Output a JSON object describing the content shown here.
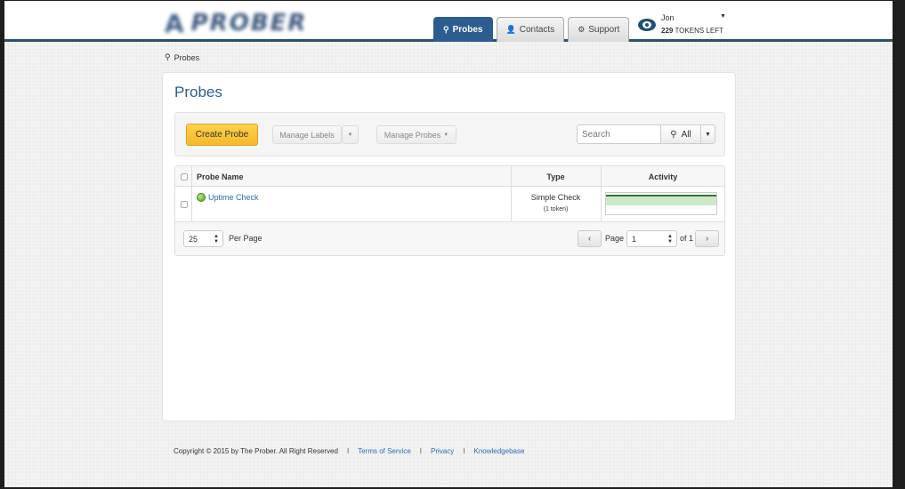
{
  "header": {
    "logo_mark": "A",
    "logo_text": "PROBER",
    "tabs": [
      {
        "label": "Probes",
        "icon": "map-pin-icon",
        "active": true
      },
      {
        "label": "Contacts",
        "icon": "user-icon",
        "active": false
      },
      {
        "label": "Support",
        "icon": "gear-icon",
        "active": false
      }
    ],
    "user": {
      "name": "Jon",
      "tokens_count": "229",
      "tokens_label": "TOKENS LEFT"
    }
  },
  "breadcrumb": {
    "label": "Probes"
  },
  "main": {
    "title": "Probes",
    "toolbar": {
      "create_label": "Create Probe",
      "manage_labels": "Manage Labels",
      "manage_probes": "Manage Probes",
      "search_placeholder": "Search",
      "search_scope": "All"
    },
    "table": {
      "headers": {
        "name": "Probe Name",
        "type": "Type",
        "activity": "Activity"
      },
      "rows": [
        {
          "name": "Uptime Check",
          "type": "Simple Check",
          "tokens": "(1 token)",
          "status": "up"
        }
      ],
      "footer": {
        "per_page_value": "25",
        "per_page_label": "Per Page",
        "page_label": "Page",
        "page_value": "1",
        "of_label": "of 1"
      }
    }
  },
  "footer": {
    "copyright": "Copyright © 2015 by The Prober. All Right Reserved",
    "separator": "I",
    "links": [
      "Terms of Service",
      "Privacy",
      "Knowledgebase"
    ]
  },
  "colors": {
    "brand": "#2b5d8e",
    "create_button": "#f5b82a",
    "link": "#2a6db0",
    "status_ok": "#4ea11c"
  }
}
